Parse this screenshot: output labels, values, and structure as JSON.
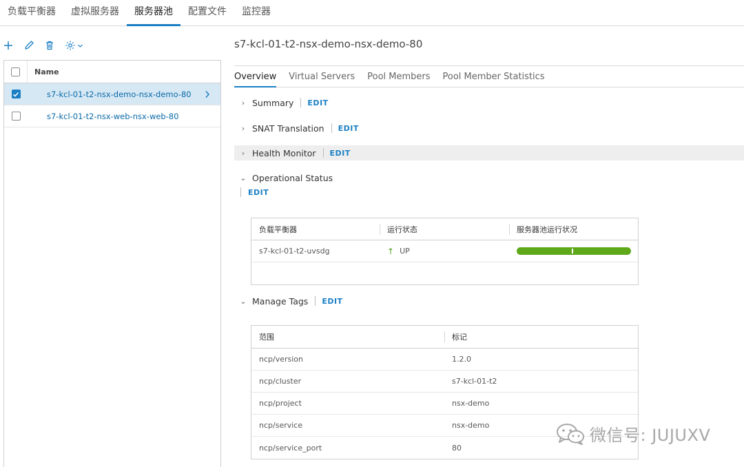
{
  "nav": {
    "tabs": [
      {
        "label": "负载平衡器"
      },
      {
        "label": "虚拟服务器"
      },
      {
        "label": "服务器池"
      },
      {
        "label": "配置文件"
      },
      {
        "label": "监控器"
      }
    ],
    "active_index": 2
  },
  "toolbar": {
    "add_icon": "plus-icon",
    "edit_icon": "pencil-icon",
    "delete_icon": "trash-icon",
    "settings_icon": "gear-icon"
  },
  "pool_list": {
    "column_name": "Name",
    "items": [
      {
        "name": "s7-kcl-01-t2-nsx-demo-nsx-demo-80",
        "selected": true
      },
      {
        "name": "s7-kcl-01-t2-nsx-web-nsx-web-80",
        "selected": false
      }
    ]
  },
  "detail": {
    "title": "s7-kcl-01-t2-nsx-demo-nsx-demo-80",
    "tabs": [
      "Overview",
      "Virtual Servers",
      "Pool Members",
      "Pool Member Statistics"
    ],
    "edit_label": "EDIT",
    "sections": {
      "summary": "Summary",
      "snat": "SNAT Translation",
      "health": "Health Monitor",
      "operational": "Operational Status",
      "tags": "Manage Tags"
    },
    "operational_status": {
      "headers": [
        "负载平衡器",
        "运行状态",
        "服务器池运行状况"
      ],
      "rows": [
        {
          "load_balancer": "s7-kcl-01-t2-uvsdg",
          "status": "UP",
          "health_fraction": 1.0
        }
      ],
      "status_color": "#5ea81a"
    },
    "tags": {
      "headers": [
        "范围",
        "标记"
      ],
      "rows": [
        {
          "scope": "ncp/version",
          "tag": "1.2.0"
        },
        {
          "scope": "ncp/cluster",
          "tag": "s7-kcl-01-t2"
        },
        {
          "scope": "ncp/project",
          "tag": "nsx-demo"
        },
        {
          "scope": "ncp/service",
          "tag": "nsx-demo"
        },
        {
          "scope": "ncp/service_port",
          "tag": "80"
        }
      ]
    }
  },
  "watermark": {
    "text": "微信号: JUJUXV",
    "icon": "wechat-icon"
  },
  "colors": {
    "accent": "#1a7fc4",
    "selected_row": "#d7e8f5",
    "success": "#5ea81a"
  }
}
